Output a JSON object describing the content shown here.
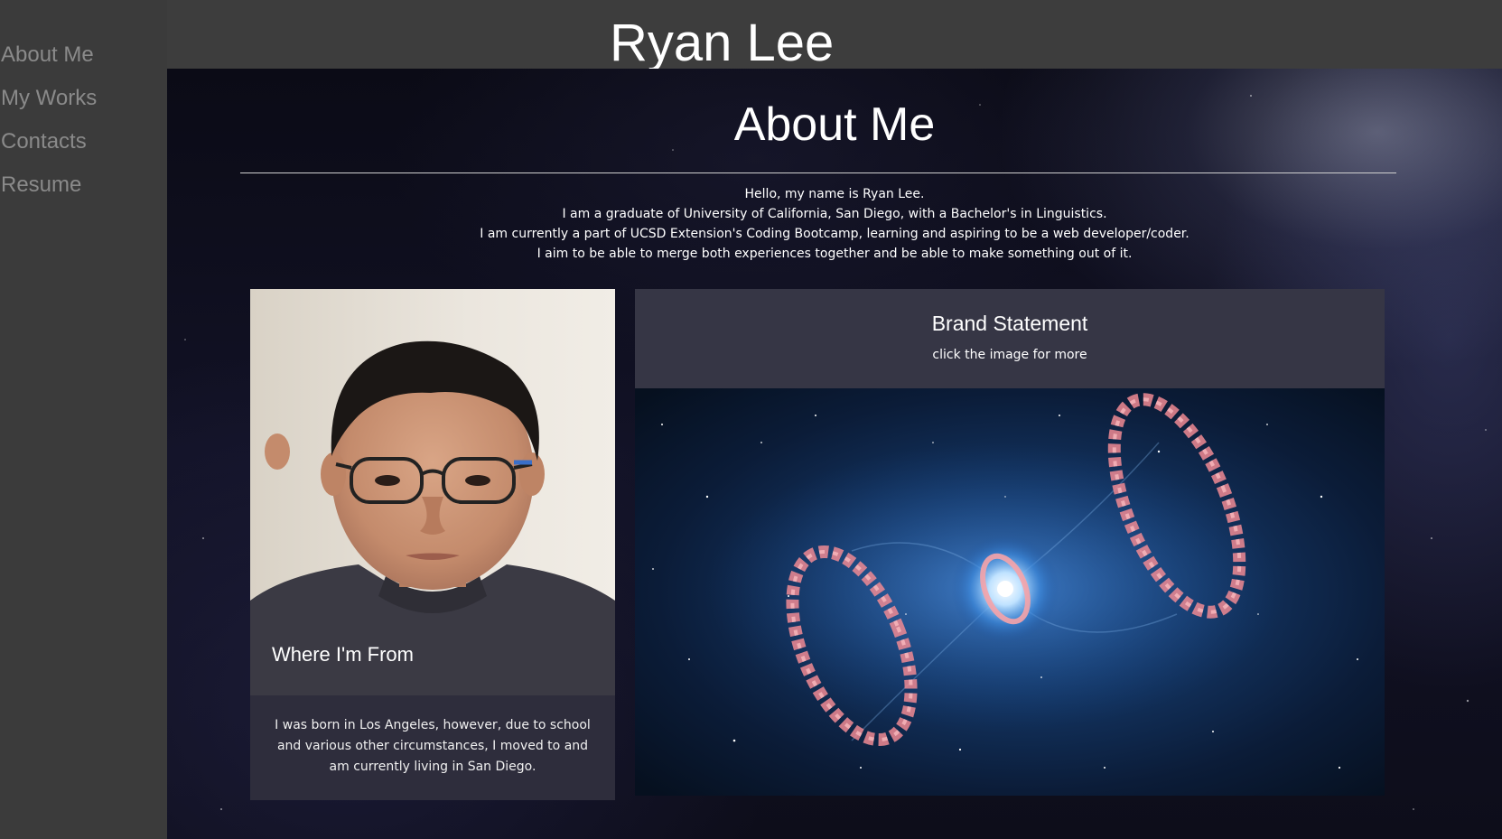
{
  "sidebar": {
    "items": [
      {
        "label": "About Me"
      },
      {
        "label": "My Works"
      },
      {
        "label": "Contacts"
      },
      {
        "label": "Resume"
      }
    ]
  },
  "header": {
    "title": "Ryan Lee"
  },
  "main": {
    "heading": "About Me",
    "intro": [
      "Hello, my name is Ryan Lee.",
      "I am a graduate of University of California, San Diego, with a Bachelor's in Linguistics.",
      "I am currently a part of UCSD Extension's Coding Bootcamp, learning and aspiring to be a web developer/coder.",
      "I aim to be able to merge both experiences together and be able to make something out of it."
    ],
    "card_left": {
      "caption": "Where I'm From",
      "text": "I was born in Los Angeles, however, due to school and various other circumstances, I moved to and am currently living in San Diego."
    },
    "card_right": {
      "title": "Brand Statement",
      "subtitle": "click the image for more"
    }
  },
  "colors": {
    "sidebar_bg": "#3b3b3b",
    "header_bg": "#3d3d3d",
    "nav_text": "#8a8a8a"
  }
}
